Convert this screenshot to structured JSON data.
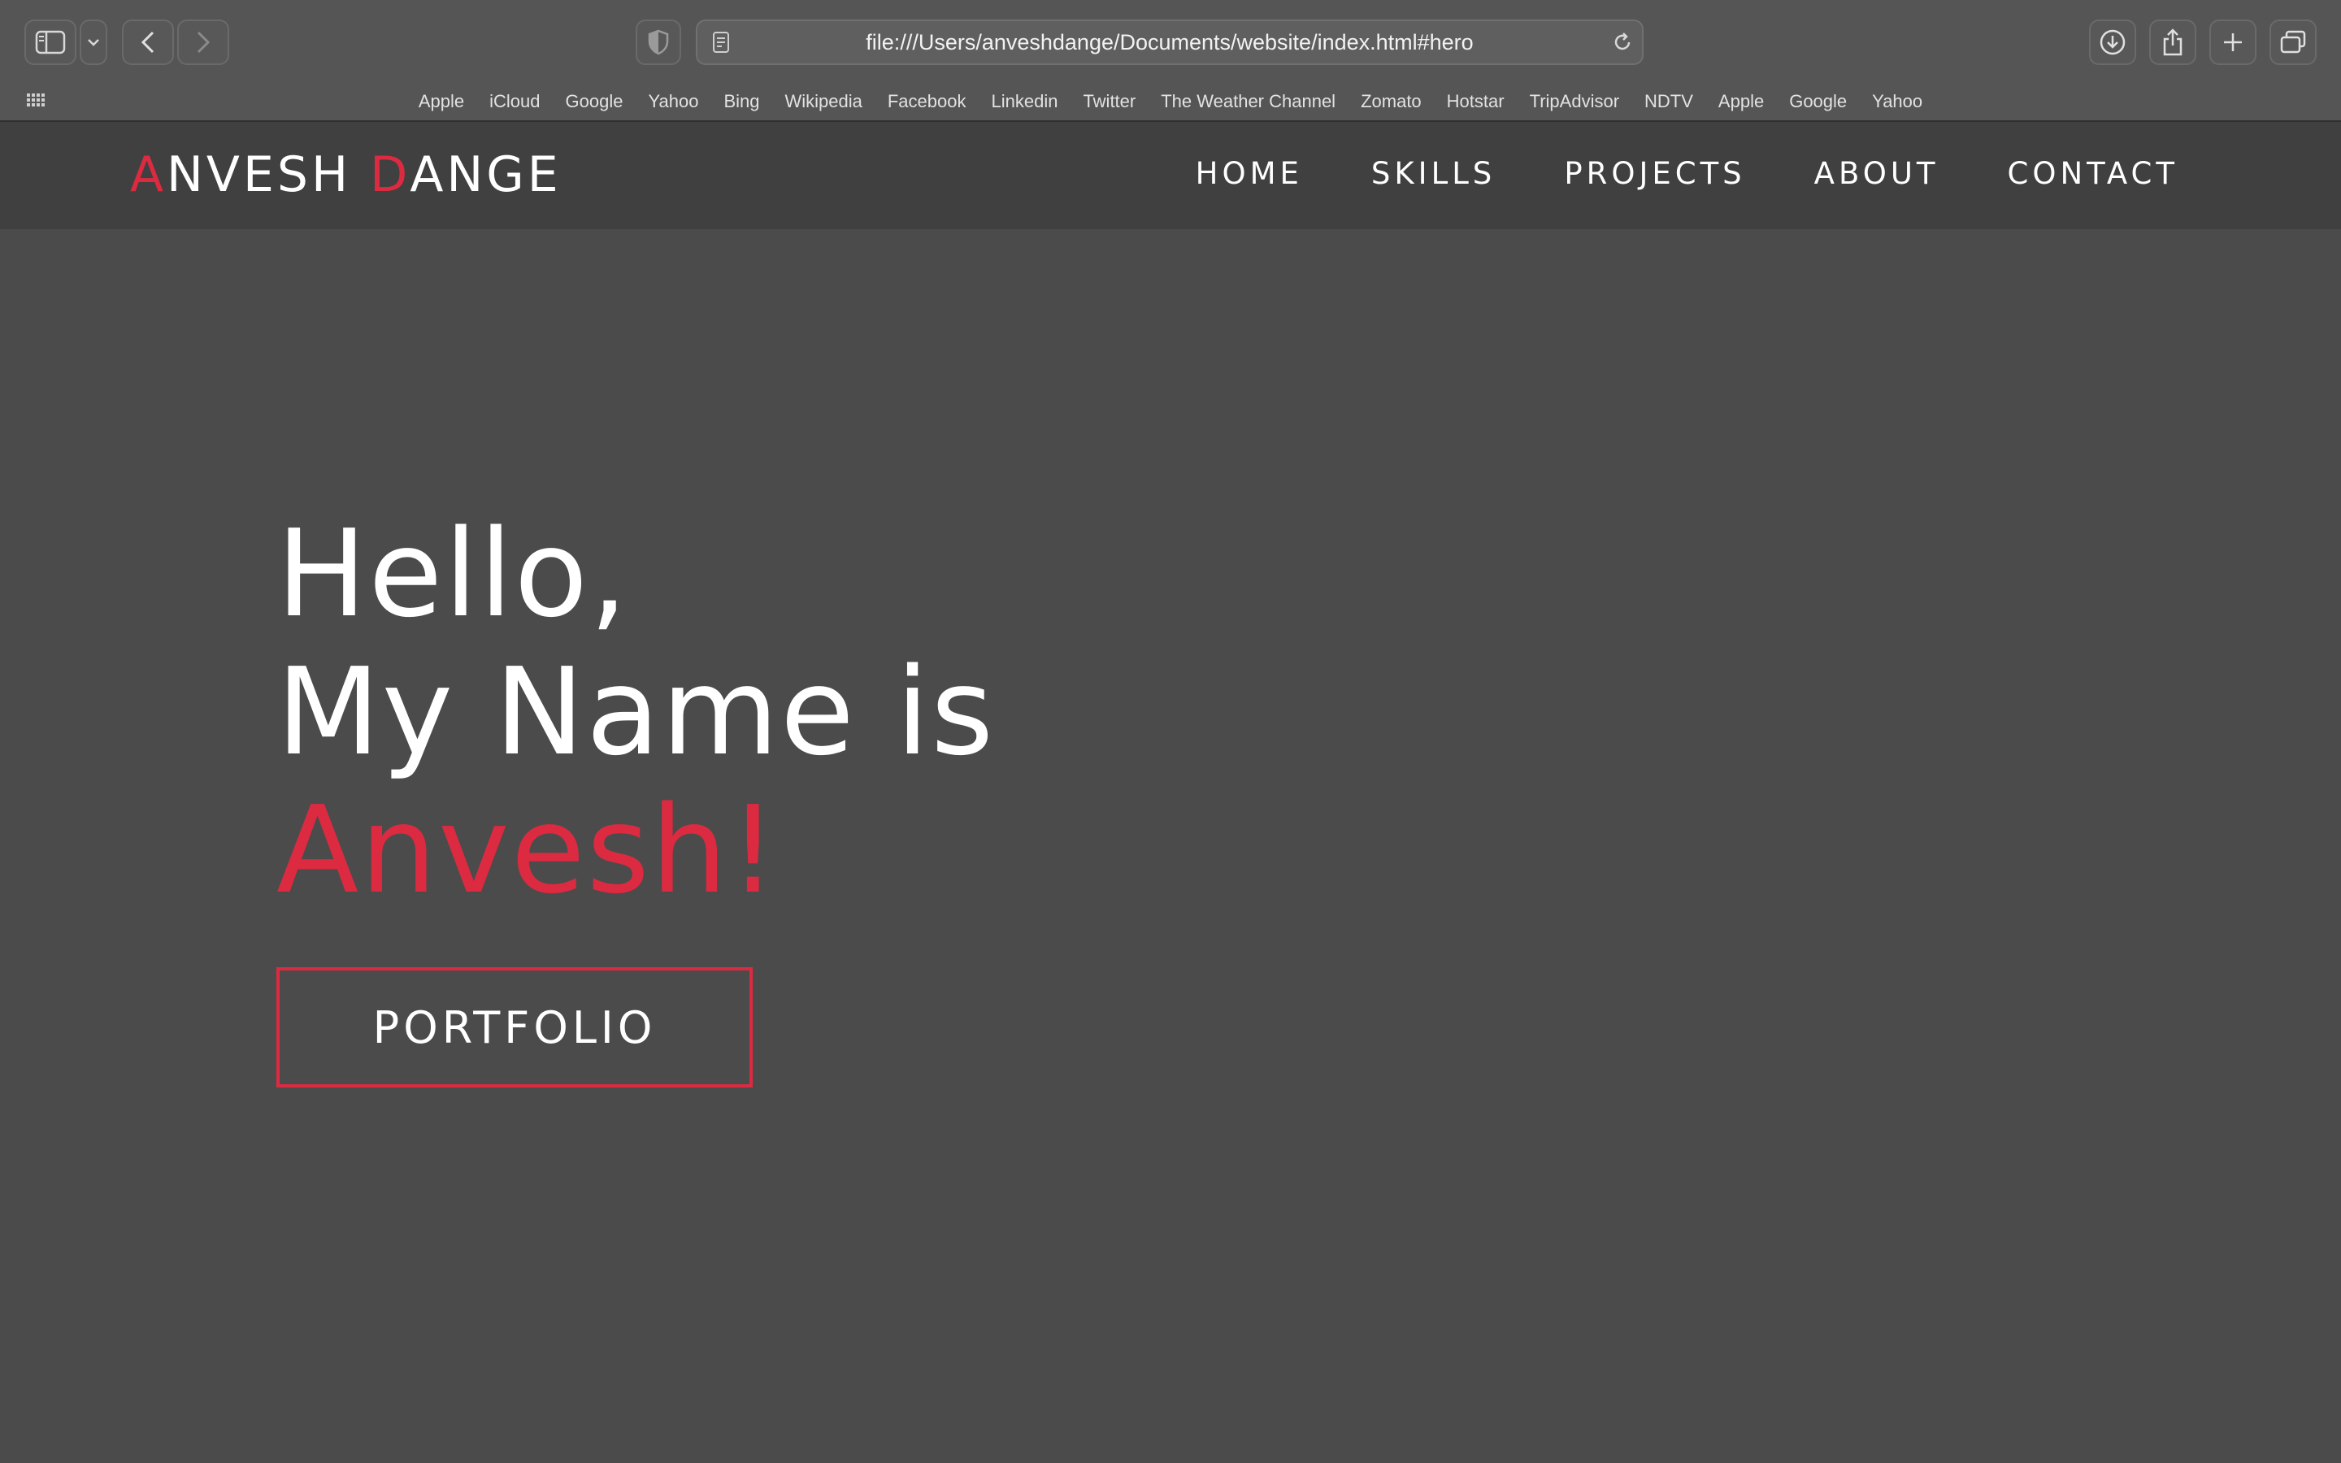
{
  "browser": {
    "url": "file:///Users/anveshdange/Documents/website/index.html#hero",
    "icons": {
      "sidebar": "sidebar-icon",
      "tab_group_menu": "chevron-down-icon",
      "back": "chevron-left-icon",
      "forward": "chevron-right-icon",
      "privacy": "shield-icon",
      "page": "page-icon",
      "reload": "reload-icon",
      "downloads": "download-icon",
      "share": "share-icon",
      "new_tab": "plus-icon",
      "tab_overview": "tabs-icon",
      "favorites_grid": "grid-icon"
    },
    "favorites": [
      "Apple",
      "iCloud",
      "Google",
      "Yahoo",
      "Bing",
      "Wikipedia",
      "Facebook",
      "Linkedin",
      "Twitter",
      "The Weather Channel",
      "Zomato",
      "Hotstar",
      "TripAdvisor",
      "NDTV",
      "Apple",
      "Google",
      "Yahoo"
    ]
  },
  "site": {
    "logo": {
      "first_initial": "A",
      "first_rest": "NVESH",
      "last_initial": "D",
      "last_rest": "ANGE"
    },
    "nav": [
      "HOME",
      "SKILLS",
      "PROJECTS",
      "ABOUT",
      "CONTACT"
    ],
    "hero": {
      "line1": "Hello,",
      "line2": "My Name is",
      "line3": "Anvesh!",
      "button": "PORTFOLIO"
    }
  },
  "colors": {
    "accent": "#dc2a41",
    "page_background": "#4b4b4b",
    "header_background": "#404040",
    "browser_chrome": "#555556"
  }
}
